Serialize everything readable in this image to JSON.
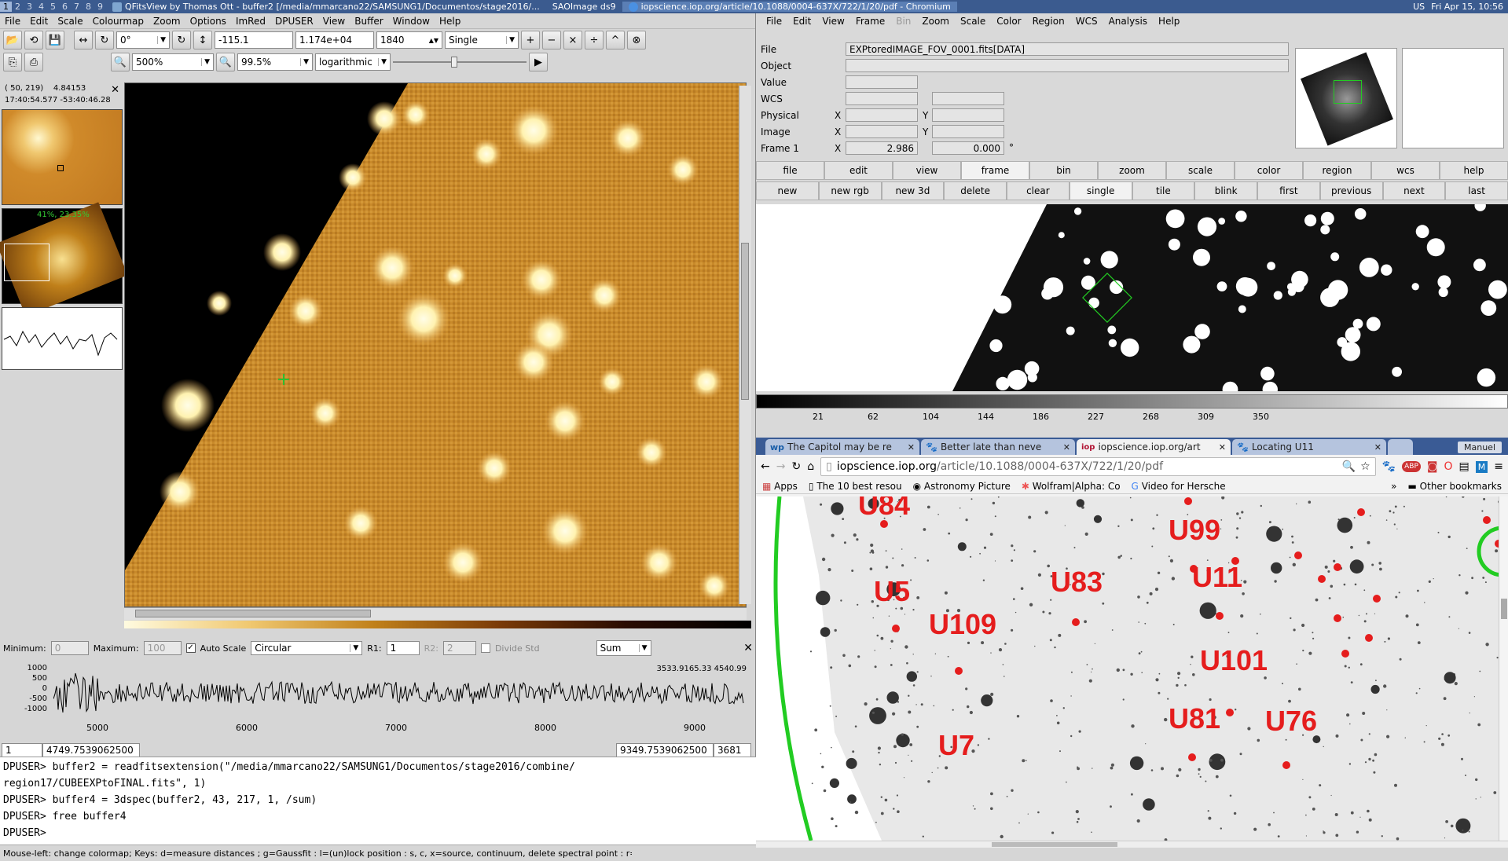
{
  "taskbar": {
    "workspaces": [
      "1",
      "2",
      "3",
      "4",
      "5",
      "6",
      "7",
      "8",
      "9"
    ],
    "active_workspace": "1",
    "tasks": [
      {
        "label": "QFitsView by Thomas Ott - buffer2 [/media/mmarcano22/SAMSUNG1/Documentos/stage2016/...",
        "active": false
      },
      {
        "label": "SAOImage ds9",
        "active": false
      },
      {
        "label": "iopscience.iop.org/article/10.1088/0004-637X/722/1/20/pdf - Chromium",
        "active": true
      }
    ],
    "locale": "US",
    "clock": "Fri Apr 15, 10:56"
  },
  "qfitsview": {
    "menu": [
      "File",
      "Edit",
      "Scale",
      "Colourmap",
      "Zoom",
      "Options",
      "ImRed",
      "DPUSER",
      "View",
      "Buffer",
      "Window",
      "Help"
    ],
    "toolbar": {
      "rotation": "0°",
      "value1": "-115.1",
      "value2": "1.174e+04",
      "slice": "1840",
      "mode": "Single",
      "zoom": "500%",
      "percent": "99.5%",
      "scale": "logarithmic"
    },
    "cursor_info": {
      "pixel": "( 50, 219)",
      "value": "4.84153",
      "coords": "17:40:54.577 -53:40:46.28"
    },
    "overview_label": "41%, 23.35%",
    "spectrum": {
      "min_label": "Minimum:",
      "min_val": "0",
      "max_label": "Maximum:",
      "max_val": "100",
      "autoscale": "Auto Scale",
      "aperture": "Circular",
      "r1_label": "R1:",
      "r1": "1",
      "r2_label": "R2:",
      "r2": "2",
      "divide": "Divide Std",
      "method": "Sum",
      "yticks": [
        "1000",
        "500",
        "0",
        "-500",
        "-1000"
      ],
      "xticks": [
        "5000",
        "6000",
        "7000",
        "8000",
        "9000"
      ],
      "readout": "3533.9165.33 4540.99",
      "nav_start": "1",
      "nav_from": "4749.7539062500",
      "nav_to": "9349.7539062500",
      "nav_end": "3681"
    },
    "console": [
      "DPUSER> buffer2 = readfitsextension(\"/media/mmarcano22/SAMSUNG1/Documentos/stage2016/combine/",
      "region17/CUBEEXPtoFINAL.fits\", 1)",
      "DPUSER> buffer4 = 3dspec(buffer2, 43, 217, 1, /sum)",
      "DPUSER> free buffer4",
      "DPUSER>"
    ],
    "status": "Mouse-left: change colormap; Keys: d=measure distances ; g=Gaussfit : l=(un)lock position : s, c, x=source, continuum, delete spectral point : r=remo"
  },
  "ds9": {
    "menu": [
      "File",
      "Edit",
      "View",
      "Frame",
      "Bin",
      "Zoom",
      "Scale",
      "Color",
      "Region",
      "WCS",
      "Analysis",
      "Help"
    ],
    "info": {
      "file_label": "File",
      "file": "EXPtoredIMAGE_FOV_0001.fits[DATA]",
      "object_label": "Object",
      "value_label": "Value",
      "wcs_label": "WCS",
      "physical_label": "Physical",
      "image_label": "Image",
      "frame_label": "Frame 1",
      "x": "X",
      "y": "Y",
      "frame_x": "2.986",
      "frame_y": "0.000",
      "deg": "°"
    },
    "buttons1": [
      "file",
      "edit",
      "view",
      "frame",
      "bin",
      "zoom",
      "scale",
      "color",
      "region",
      "wcs",
      "help"
    ],
    "buttons1_selected": "frame",
    "buttons2": [
      "new",
      "new rgb",
      "new 3d",
      "delete",
      "clear",
      "single",
      "tile",
      "blink",
      "first",
      "previous",
      "next",
      "last"
    ],
    "buttons2_selected": "single",
    "colorbar_ticks": [
      "21",
      "62",
      "104",
      "144",
      "186",
      "227",
      "268",
      "309",
      "350"
    ]
  },
  "chromium": {
    "tabs": [
      {
        "label": "The Capitol may be re",
        "active": false
      },
      {
        "label": "Better late than neve",
        "active": false
      },
      {
        "label": "iopscience.iop.org/art",
        "active": true
      },
      {
        "label": "Locating U11",
        "active": false
      }
    ],
    "profile": "Manuel",
    "url_host": "iopscience.iop.org",
    "url_path": "/article/10.1088/0004-637X/722/1/20/pdf",
    "bookmarks": [
      "Apps",
      "The 10 best resou",
      "Astronomy Picture",
      "Wolfram|Alpha: Co",
      "Video for Hersche"
    ],
    "other_bookmarks": "Other bookmarks",
    "pdf_labels": [
      "U84",
      "U99",
      "U5",
      "U83",
      "U11",
      "U109",
      "U101",
      "U81",
      "U76",
      "U7"
    ]
  },
  "colors": {
    "accent": "#3a5b95",
    "label_red": "#e51d1d",
    "region_green": "#22cc22"
  }
}
